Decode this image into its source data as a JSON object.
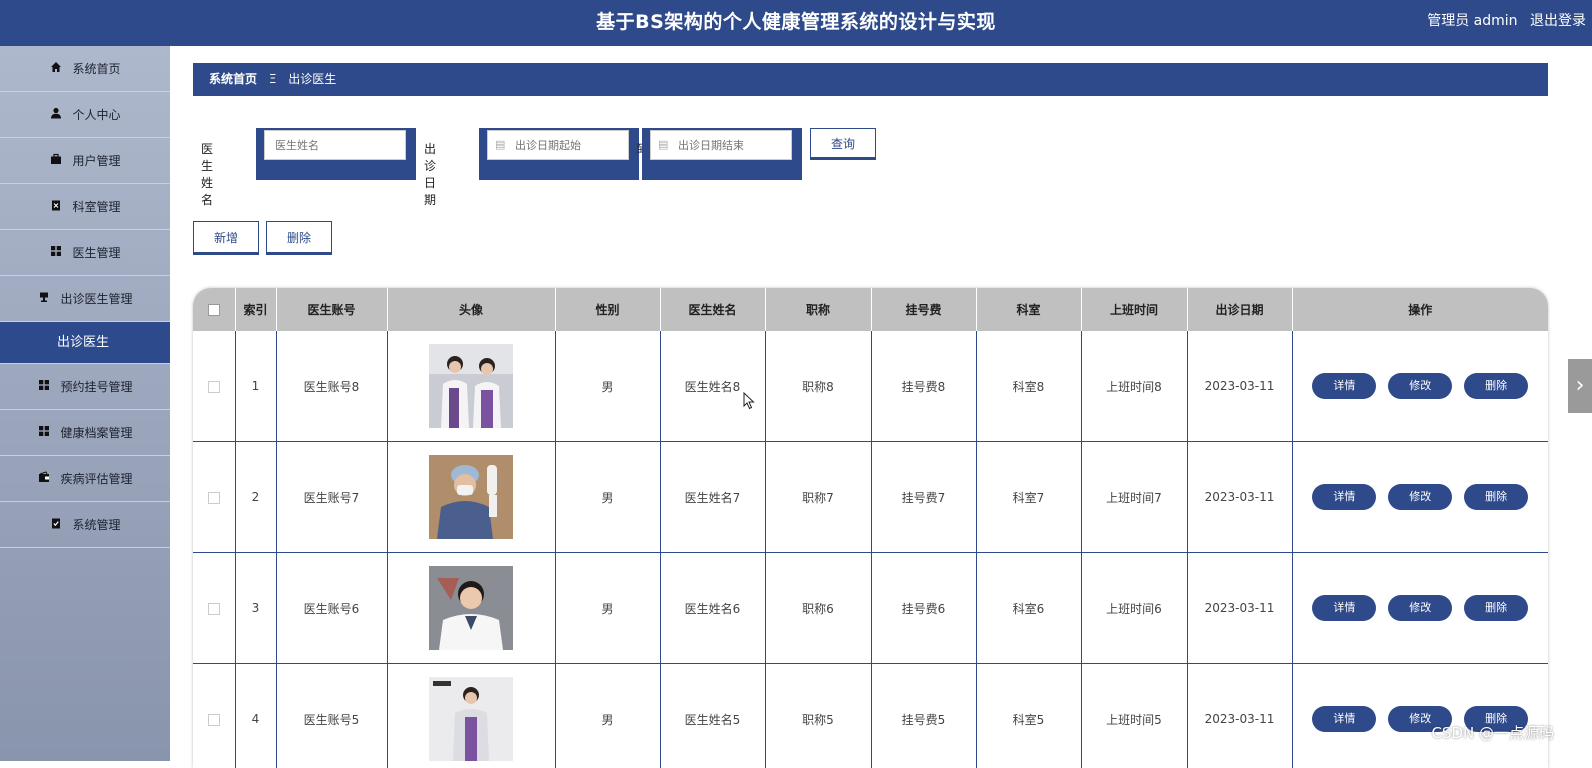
{
  "header": {
    "title": "基于BS架构的个人健康管理系统的设计与实现",
    "user": "管理员 admin",
    "logout": "退出登录"
  },
  "sidebar": {
    "items": [
      {
        "label": "系统首页",
        "icon": "home-icon"
      },
      {
        "label": "个人中心",
        "icon": "user-icon"
      },
      {
        "label": "用户管理",
        "icon": "briefcase-icon"
      },
      {
        "label": "科室管理",
        "icon": "clipboard-icon"
      },
      {
        "label": "医生管理",
        "icon": "grid-icon"
      },
      {
        "label": "出诊医生管理",
        "icon": "desk-icon"
      }
    ],
    "active_sub": "出诊医生",
    "items_after": [
      {
        "label": "预约挂号管理",
        "icon": "grid-icon"
      },
      {
        "label": "健康档案管理",
        "icon": "grid-icon"
      },
      {
        "label": "疾病评估管理",
        "icon": "wallet-icon"
      },
      {
        "label": "系统管理",
        "icon": "clipboard-check-icon"
      }
    ]
  },
  "breadcrumb": {
    "home": "系统首页",
    "separator": "Ξ",
    "current": "出诊医生"
  },
  "search": {
    "name_label": "医生姓名",
    "name_placeholder": "医生姓名",
    "date_label": "出诊日期",
    "date_start_placeholder": "出诊日期起始",
    "date_end_placeholder": "出诊日期结束",
    "date_sep": "至",
    "query_button": "查询"
  },
  "actions": {
    "add": "新增",
    "delete": "删除"
  },
  "table": {
    "columns": [
      "索引",
      "医生账号",
      "头像",
      "性别",
      "医生姓名",
      "职称",
      "挂号费",
      "科室",
      "上班时间",
      "出诊日期",
      "操作"
    ],
    "op_labels": {
      "detail": "详情",
      "edit": "修改",
      "delete": "删除"
    },
    "rows": [
      {
        "index": "1",
        "account": "医生账号8",
        "gender": "男",
        "name": "医生姓名8",
        "title": "职称8",
        "fee": "挂号费8",
        "dept": "科室8",
        "work_time": "上班时间8",
        "date": "2023-03-11"
      },
      {
        "index": "2",
        "account": "医生账号7",
        "gender": "男",
        "name": "医生姓名7",
        "title": "职称7",
        "fee": "挂号费7",
        "dept": "科室7",
        "work_time": "上班时间7",
        "date": "2023-03-11"
      },
      {
        "index": "3",
        "account": "医生账号6",
        "gender": "男",
        "name": "医生姓名6",
        "title": "职称6",
        "fee": "挂号费6",
        "dept": "科室6",
        "work_time": "上班时间6",
        "date": "2023-03-11"
      },
      {
        "index": "4",
        "account": "医生账号5",
        "gender": "男",
        "name": "医生姓名5",
        "title": "职称5",
        "fee": "挂号费5",
        "dept": "科室5",
        "work_time": "上班时间5",
        "date": "2023-03-11"
      }
    ]
  },
  "watermark": "CSDN @一点源码",
  "colors": {
    "primary": "#2e4a8a",
    "header_gray": "#c0c0c0"
  }
}
